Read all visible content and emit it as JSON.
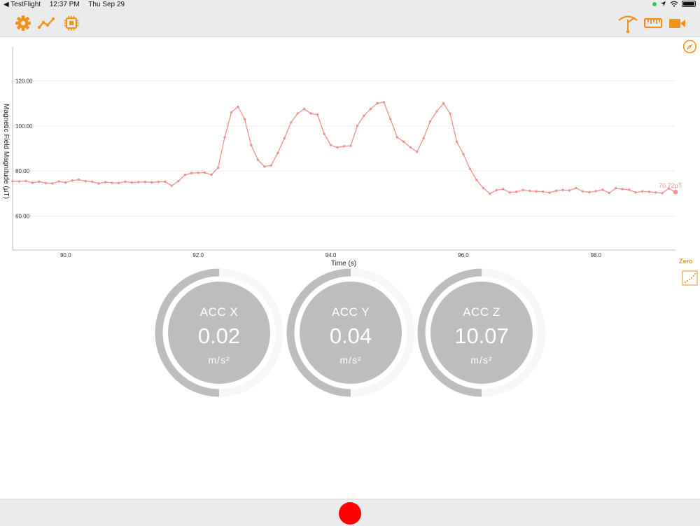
{
  "status_bar": {
    "back_app": "◀ TestFlight",
    "time": "12:37 PM",
    "date": "Thu Sep 29"
  },
  "toolbar": {
    "left_icons": [
      "gear-icon",
      "line-graph-icon",
      "chip-icon"
    ],
    "right_icons": [
      "antenna-icon",
      "ruler-icon",
      "video-camera-icon"
    ],
    "accent_color": "#f39218"
  },
  "chart_data": {
    "type": "line",
    "title": "",
    "xlabel": "Time (s)",
    "ylabel": "Magnetic Field Magnitude (µT)",
    "xlim": [
      89.2,
      99.2
    ],
    "ylim": [
      45,
      135
    ],
    "x_ticks": [
      "90.0",
      "92.0",
      "94.0",
      "96.0",
      "98.0"
    ],
    "x_tick_values": [
      90,
      92,
      94,
      96,
      98
    ],
    "y_ticks": [
      "60.00",
      "80.00",
      "100.00",
      "120.00"
    ],
    "y_tick_values": [
      60,
      80,
      100,
      120
    ],
    "grid": true,
    "line_color": "#f4918f",
    "current_value_label": "70.72µT",
    "series": [
      {
        "x": [
          89.2,
          89.3,
          89.4,
          89.5,
          89.6,
          89.7,
          89.8,
          89.9,
          90.0,
          90.1,
          90.2,
          90.3,
          90.4,
          90.5,
          90.6,
          90.7,
          90.8,
          90.9,
          91.0,
          91.1,
          91.2,
          91.3,
          91.4,
          91.5,
          91.6,
          91.7,
          91.8,
          91.9,
          92.0,
          92.1,
          92.2,
          92.3,
          92.4,
          92.5,
          92.6,
          92.7,
          92.8,
          92.9,
          93.0,
          93.1,
          93.2,
          93.3,
          93.4,
          93.5,
          93.6,
          93.7,
          93.8,
          93.9,
          94.0,
          94.1,
          94.2,
          94.3,
          94.4,
          94.5,
          94.6,
          94.7,
          94.8,
          94.9,
          95.0,
          95.1,
          95.2,
          95.3,
          95.4,
          95.5,
          95.6,
          95.7,
          95.8,
          95.9,
          96.0,
          96.1,
          96.2,
          96.3,
          96.4,
          96.5,
          96.6,
          96.7,
          96.8,
          96.9,
          97.0,
          97.1,
          97.2,
          97.3,
          97.4,
          97.5,
          97.6,
          97.7,
          97.8,
          97.9,
          98.0,
          98.1,
          98.2,
          98.3,
          98.4,
          98.5,
          98.6,
          98.7,
          98.8,
          98.9,
          99.0,
          99.1,
          99.2
        ],
        "y": [
          75.5,
          75.4,
          75.6,
          74.8,
          75.3,
          74.7,
          74.5,
          75.4,
          74.9,
          75.8,
          76.2,
          75.5,
          75.3,
          74.5,
          75.1,
          74.8,
          74.7,
          75.3,
          74.9,
          75.1,
          75.2,
          75.0,
          75.2,
          75.3,
          73.5,
          75.5,
          78.3,
          79.1,
          79.2,
          79.3,
          78.4,
          81.5,
          95.0,
          106.0,
          108.5,
          103.0,
          91.5,
          85.0,
          82.0,
          82.5,
          88.0,
          94.5,
          101.5,
          105.5,
          107.5,
          105.5,
          105.0,
          96.5,
          91.5,
          90.5,
          91.0,
          91.2,
          100.0,
          104.5,
          107.5,
          110.0,
          110.5,
          103.0,
          95.0,
          93.0,
          90.5,
          88.5,
          94.5,
          102.0,
          106.5,
          110.0,
          105.5,
          93.0,
          87.5,
          81.0,
          76.0,
          72.5,
          70.0,
          71.5,
          72.0,
          70.5,
          70.8,
          71.6,
          71.2,
          71.0,
          70.9,
          70.4,
          71.3,
          71.6,
          71.4,
          72.5,
          71.0,
          70.6,
          71.1,
          71.7,
          70.3,
          72.4,
          72.0,
          71.7,
          70.5,
          71.0,
          70.8,
          70.5,
          70.2,
          72.3,
          70.7
        ]
      }
    ]
  },
  "side_controls": {
    "zero_label": "Zero"
  },
  "gauges": [
    {
      "title": "ACC X",
      "value": "0.02",
      "unit": "m/s²",
      "fill_fraction": 0.5
    },
    {
      "title": "ACC Y",
      "value": "0.04",
      "unit": "m/s²",
      "fill_fraction": 0.5
    },
    {
      "title": "ACC Z",
      "value": "10.07",
      "unit": "m/s²",
      "fill_fraction": 0.5
    }
  ],
  "bottom_bar": {
    "record_button_color": "#ff0000"
  }
}
